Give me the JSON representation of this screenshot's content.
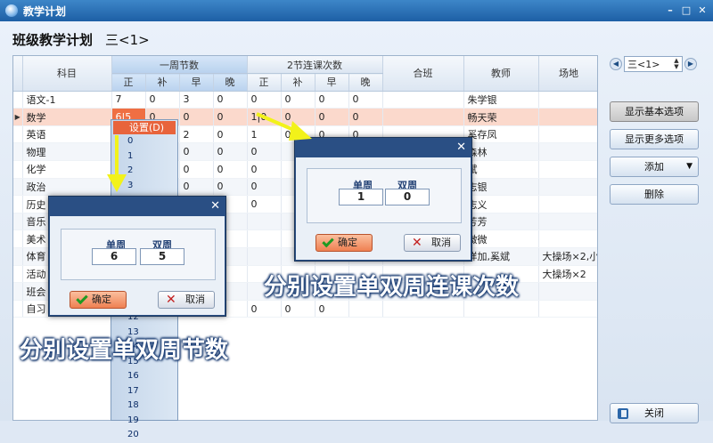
{
  "window": {
    "title": "教学计划",
    "minimize": "–",
    "maximize": "□",
    "close": "✕"
  },
  "header": {
    "title": "班级教学计划",
    "class_name": "三<1>"
  },
  "table": {
    "groups": {
      "weekly": "一周节数",
      "double": "2节连课次数"
    },
    "col_subject": "科目",
    "sub_cols": [
      "正",
      "补",
      "早",
      "晚"
    ],
    "col_combined": "合班",
    "col_teacher": "教师",
    "col_venue": "场地",
    "rows": [
      {
        "subject": "语文-1",
        "w": [
          "7",
          "0",
          "3",
          "0"
        ],
        "d": [
          "0",
          "0",
          "0",
          "0"
        ],
        "teacher": "朱学银",
        "venue": ""
      },
      {
        "subject": "数学",
        "w": [
          "6|5",
          "0",
          "0",
          "0"
        ],
        "d": [
          "1|0",
          "0",
          "0",
          "0"
        ],
        "teacher": "畅天荣",
        "venue": ""
      },
      {
        "subject": "英语",
        "w": [
          "",
          "",
          "2",
          "0"
        ],
        "d": [
          "1",
          "0",
          "0",
          "0"
        ],
        "teacher": "奚存凤",
        "venue": ""
      },
      {
        "subject": "物理",
        "w": [
          "",
          "",
          "0",
          "0"
        ],
        "d": [
          "0",
          "",
          "",
          ""
        ],
        "teacher": "森林",
        "venue": ""
      },
      {
        "subject": "化学",
        "w": [
          "",
          "",
          "0",
          "0"
        ],
        "d": [
          "0",
          "",
          "",
          ""
        ],
        "teacher": "斌",
        "venue": ""
      },
      {
        "subject": "政治",
        "w": [
          "",
          "",
          "0",
          "0"
        ],
        "d": [
          "0",
          "",
          "",
          ""
        ],
        "teacher": "志银",
        "venue": ""
      },
      {
        "subject": "历史",
        "w": [
          "",
          "",
          "0",
          "0"
        ],
        "d": [
          "0",
          "",
          "",
          ""
        ],
        "teacher": "志义",
        "venue": ""
      },
      {
        "subject": "音乐",
        "w": [
          "",
          "",
          "",
          ""
        ],
        "d": [
          "",
          "",
          "",
          ""
        ],
        "teacher": "芳芳",
        "venue": ""
      },
      {
        "subject": "美术",
        "w": [
          "",
          "",
          "",
          ""
        ],
        "d": [
          "",
          "",
          "",
          ""
        ],
        "teacher": "微微",
        "venue": ""
      },
      {
        "subject": "体育",
        "w": [
          "",
          "",
          "",
          ""
        ],
        "d": [
          "",
          "",
          "",
          ""
        ],
        "teacher": "详加,奚斌",
        "venue": "大操场×2,小操场×1"
      },
      {
        "subject": "活动",
        "w": [
          "",
          "",
          "",
          ""
        ],
        "d": [
          "",
          "",
          "",
          ""
        ],
        "teacher": "",
        "venue": "大操场×2"
      },
      {
        "subject": "班会",
        "w": [
          "",
          "",
          "",
          ""
        ],
        "d": [
          "",
          "",
          "",
          ""
        ],
        "teacher": "",
        "venue": ""
      },
      {
        "subject": "自习",
        "w": [
          "",
          "",
          "",
          ""
        ],
        "d": [
          "0",
          "0",
          "0",
          ""
        ],
        "teacher": "",
        "venue": ""
      }
    ]
  },
  "side": {
    "nav_value": "三<1>",
    "nav_prev": "◀",
    "nav_next": "▶",
    "btn_basic": "显示基本选项",
    "btn_more": "显示更多选项",
    "btn_add": "添加",
    "btn_delete": "删除",
    "btn_close": "关闭"
  },
  "dropdown": {
    "header": "设置(D)",
    "items": [
      "0",
      "1",
      "2",
      "3",
      "4",
      "5",
      "6",
      "7",
      "8",
      "9",
      "10",
      "11",
      "12",
      "13",
      "14",
      "15",
      "16",
      "17",
      "18",
      "19",
      "20"
    ]
  },
  "dialog_weekly": {
    "label_single": "单周",
    "label_double": "双周",
    "value_single": "6",
    "value_double": "5",
    "ok": "确定",
    "cancel": "取消"
  },
  "dialog_double": {
    "label_single": "单周",
    "label_double": "双周",
    "value_single": "1",
    "value_double": "0",
    "ok": "确定",
    "cancel": "取消"
  },
  "captions": {
    "weekly": "分别设置单双周节数",
    "double": "分别设置单双周连课次数"
  },
  "colors": {
    "title_bar": "#1d5fa5",
    "selected_row": "#fbd9cc",
    "accent": "#ef6f43",
    "arrow": "#f2f21a"
  }
}
